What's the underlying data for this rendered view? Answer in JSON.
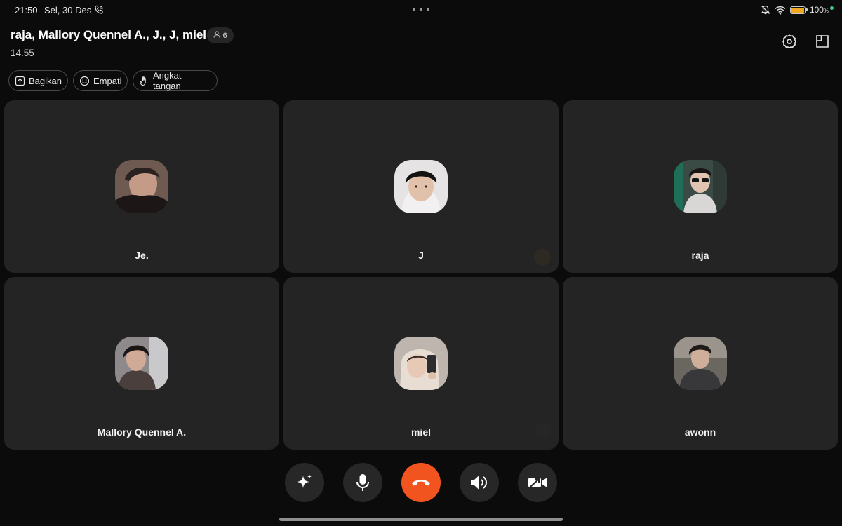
{
  "status_bar": {
    "time": "21:50",
    "date": "Sel, 30 Des",
    "battery": "100",
    "battery_unit": "%",
    "battery_level": 1.0,
    "icons": [
      "call-in-progress-icon",
      "more-dots-icon",
      "bell-muted-icon",
      "wifi-icon",
      "battery-icon",
      "green-dot-indicator"
    ]
  },
  "header": {
    "title": "raja, Mallory Quennel A., J., J, miel",
    "participant_count": "6",
    "duration": "14.55"
  },
  "actions": [
    {
      "label": "Bagikan",
      "icon": "share-icon"
    },
    {
      "label": "Empati",
      "icon": "smile-icon"
    },
    {
      "label": "Angkat tangan",
      "icon": "raise-hand-icon"
    }
  ],
  "participants": [
    {
      "name": "Je."
    },
    {
      "name": "J"
    },
    {
      "name": "raja"
    },
    {
      "name": "Mallory Quennel A."
    },
    {
      "name": "miel"
    },
    {
      "name": "awonn"
    }
  ],
  "controls": [
    {
      "name": "ai-effects",
      "icon": "sparkle-icon"
    },
    {
      "name": "microphone",
      "icon": "mic-icon"
    },
    {
      "name": "end-call",
      "icon": "hang-up-icon"
    },
    {
      "name": "speaker",
      "icon": "speaker-icon"
    },
    {
      "name": "video",
      "icon": "video-off-icon"
    }
  ],
  "colors": {
    "background": "#0b0b0b",
    "tile": "#242424",
    "end_call": "#f2541f",
    "battery": "#f0a81e",
    "status_dot": "#35d07f"
  }
}
